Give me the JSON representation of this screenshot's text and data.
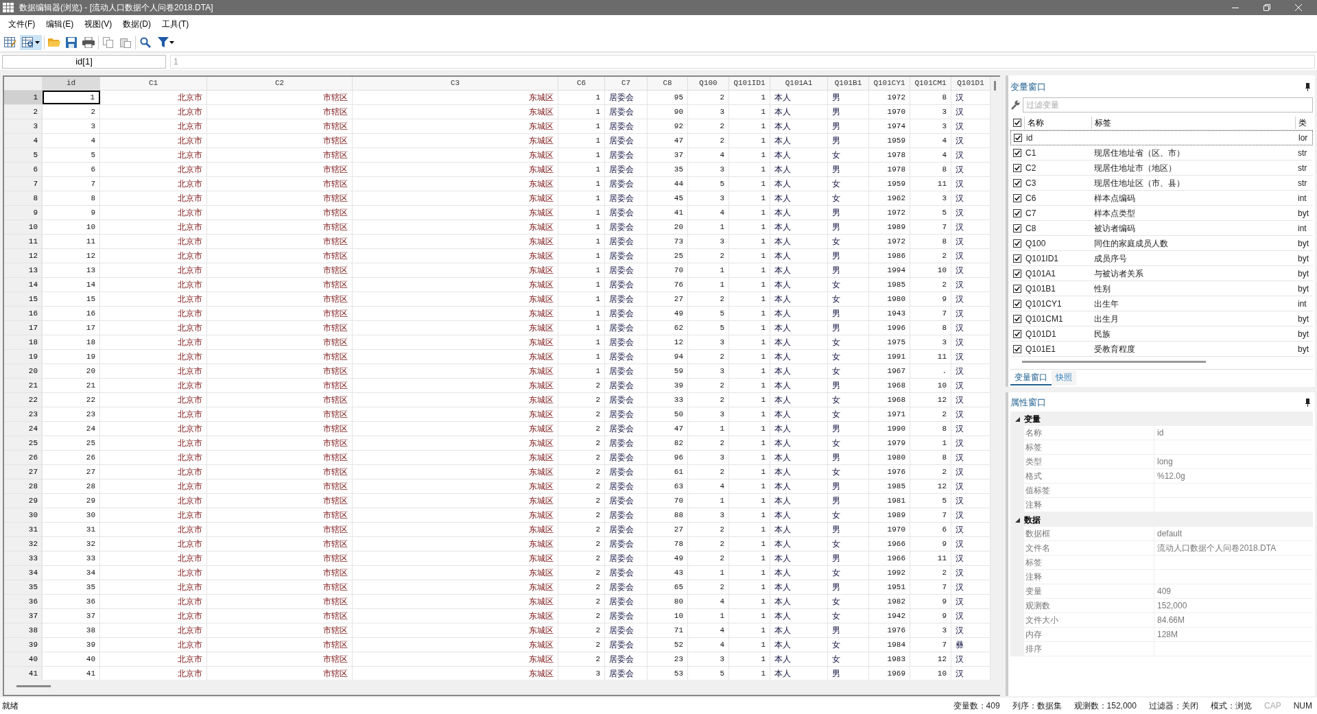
{
  "window": {
    "title": "数据编辑器(浏览) - [流动人口数据个人问卷2018.DTA]"
  },
  "menu": [
    "文件(F)",
    "编辑(E)",
    "视图(V)",
    "数据(D)",
    "工具(T)"
  ],
  "cell_editor": {
    "reference": "id[1]",
    "value": "1"
  },
  "table": {
    "columns": [
      {
        "name": "id",
        "kind": "numeric"
      },
      {
        "name": "C1",
        "kind": "string"
      },
      {
        "name": "C2",
        "kind": "string"
      },
      {
        "name": "C3",
        "kind": "string"
      },
      {
        "name": "C6",
        "kind": "numeric"
      },
      {
        "name": "C7",
        "kind": "labeled"
      },
      {
        "name": "C8",
        "kind": "numeric"
      },
      {
        "name": "Q100",
        "kind": "numeric"
      },
      {
        "name": "Q101ID1",
        "kind": "numeric"
      },
      {
        "name": "Q101A1",
        "kind": "labeled"
      },
      {
        "name": "Q101B1",
        "kind": "labeled"
      },
      {
        "name": "Q101CY1",
        "kind": "numeric"
      },
      {
        "name": "Q101CM1",
        "kind": "numeric"
      },
      {
        "name": "Q101D1",
        "kind": "labeled"
      }
    ],
    "rows": [
      {
        "number": "1",
        "selected": true,
        "cells": [
          "1",
          "北京市",
          "市辖区",
          "东城区",
          "1",
          "居委会",
          "95",
          "2",
          "1",
          "本人",
          "男",
          "1972",
          "8",
          "汉"
        ]
      },
      {
        "number": "2",
        "selected": false,
        "cells": [
          "2",
          "北京市",
          "市辖区",
          "东城区",
          "1",
          "居委会",
          "90",
          "3",
          "1",
          "本人",
          "男",
          "1970",
          "3",
          "汉"
        ]
      },
      {
        "number": "3",
        "selected": false,
        "cells": [
          "3",
          "北京市",
          "市辖区",
          "东城区",
          "1",
          "居委会",
          "92",
          "2",
          "1",
          "本人",
          "男",
          "1974",
          "3",
          "汉"
        ]
      },
      {
        "number": "4",
        "selected": false,
        "cells": [
          "4",
          "北京市",
          "市辖区",
          "东城区",
          "1",
          "居委会",
          "47",
          "2",
          "1",
          "本人",
          "男",
          "1959",
          "4",
          "汉"
        ]
      },
      {
        "number": "5",
        "selected": false,
        "cells": [
          "5",
          "北京市",
          "市辖区",
          "东城区",
          "1",
          "居委会",
          "37",
          "4",
          "1",
          "本人",
          "女",
          "1978",
          "4",
          "汉"
        ]
      },
      {
        "number": "6",
        "selected": false,
        "cells": [
          "6",
          "北京市",
          "市辖区",
          "东城区",
          "1",
          "居委会",
          "35",
          "3",
          "1",
          "本人",
          "男",
          "1978",
          "8",
          "汉"
        ]
      },
      {
        "number": "7",
        "selected": false,
        "cells": [
          "7",
          "北京市",
          "市辖区",
          "东城区",
          "1",
          "居委会",
          "44",
          "5",
          "1",
          "本人",
          "女",
          "1959",
          "11",
          "汉"
        ]
      },
      {
        "number": "8",
        "selected": false,
        "cells": [
          "8",
          "北京市",
          "市辖区",
          "东城区",
          "1",
          "居委会",
          "45",
          "3",
          "1",
          "本人",
          "女",
          "1962",
          "3",
          "汉"
        ]
      },
      {
        "number": "9",
        "selected": false,
        "cells": [
          "9",
          "北京市",
          "市辖区",
          "东城区",
          "1",
          "居委会",
          "41",
          "4",
          "1",
          "本人",
          "男",
          "1972",
          "5",
          "汉"
        ]
      },
      {
        "number": "10",
        "selected": false,
        "cells": [
          "10",
          "北京市",
          "市辖区",
          "东城区",
          "1",
          "居委会",
          "20",
          "1",
          "1",
          "本人",
          "男",
          "1989",
          "7",
          "汉"
        ]
      },
      {
        "number": "11",
        "selected": false,
        "cells": [
          "11",
          "北京市",
          "市辖区",
          "东城区",
          "1",
          "居委会",
          "73",
          "3",
          "1",
          "本人",
          "女",
          "1972",
          "8",
          "汉"
        ]
      },
      {
        "number": "12",
        "selected": false,
        "cells": [
          "12",
          "北京市",
          "市辖区",
          "东城区",
          "1",
          "居委会",
          "25",
          "2",
          "1",
          "本人",
          "男",
          "1986",
          "2",
          "汉"
        ]
      },
      {
        "number": "13",
        "selected": false,
        "cells": [
          "13",
          "北京市",
          "市辖区",
          "东城区",
          "1",
          "居委会",
          "70",
          "1",
          "1",
          "本人",
          "男",
          "1994",
          "10",
          "汉"
        ]
      },
      {
        "number": "14",
        "selected": false,
        "cells": [
          "14",
          "北京市",
          "市辖区",
          "东城区",
          "1",
          "居委会",
          "76",
          "1",
          "1",
          "本人",
          "女",
          "1985",
          "2",
          "汉"
        ]
      },
      {
        "number": "15",
        "selected": false,
        "cells": [
          "15",
          "北京市",
          "市辖区",
          "东城区",
          "1",
          "居委会",
          "27",
          "2",
          "1",
          "本人",
          "女",
          "1980",
          "9",
          "汉"
        ]
      },
      {
        "number": "16",
        "selected": false,
        "cells": [
          "16",
          "北京市",
          "市辖区",
          "东城区",
          "1",
          "居委会",
          "49",
          "5",
          "1",
          "本人",
          "男",
          "1943",
          "7",
          "汉"
        ]
      },
      {
        "number": "17",
        "selected": false,
        "cells": [
          "17",
          "北京市",
          "市辖区",
          "东城区",
          "1",
          "居委会",
          "62",
          "5",
          "1",
          "本人",
          "男",
          "1996",
          "8",
          "汉"
        ]
      },
      {
        "number": "18",
        "selected": false,
        "cells": [
          "18",
          "北京市",
          "市辖区",
          "东城区",
          "1",
          "居委会",
          "12",
          "3",
          "1",
          "本人",
          "女",
          "1975",
          "3",
          "汉"
        ]
      },
      {
        "number": "19",
        "selected": false,
        "cells": [
          "19",
          "北京市",
          "市辖区",
          "东城区",
          "1",
          "居委会",
          "94",
          "2",
          "1",
          "本人",
          "女",
          "1991",
          "11",
          "汉"
        ]
      },
      {
        "number": "20",
        "selected": false,
        "cells": [
          "20",
          "北京市",
          "市辖区",
          "东城区",
          "1",
          "居委会",
          "59",
          "3",
          "1",
          "本人",
          "女",
          "1967",
          ".",
          "汉"
        ]
      },
      {
        "number": "21",
        "selected": false,
        "cells": [
          "21",
          "北京市",
          "市辖区",
          "东城区",
          "2",
          "居委会",
          "39",
          "2",
          "1",
          "本人",
          "男",
          "1968",
          "10",
          "汉"
        ]
      },
      {
        "number": "22",
        "selected": false,
        "cells": [
          "22",
          "北京市",
          "市辖区",
          "东城区",
          "2",
          "居委会",
          "33",
          "2",
          "1",
          "本人",
          "女",
          "1968",
          "12",
          "汉"
        ]
      },
      {
        "number": "23",
        "selected": false,
        "cells": [
          "23",
          "北京市",
          "市辖区",
          "东城区",
          "2",
          "居委会",
          "50",
          "3",
          "1",
          "本人",
          "女",
          "1971",
          "2",
          "汉"
        ]
      },
      {
        "number": "24",
        "selected": false,
        "cells": [
          "24",
          "北京市",
          "市辖区",
          "东城区",
          "2",
          "居委会",
          "47",
          "1",
          "1",
          "本人",
          "男",
          "1990",
          "8",
          "汉"
        ]
      },
      {
        "number": "25",
        "selected": false,
        "cells": [
          "25",
          "北京市",
          "市辖区",
          "东城区",
          "2",
          "居委会",
          "82",
          "2",
          "1",
          "本人",
          "女",
          "1979",
          "1",
          "汉"
        ]
      },
      {
        "number": "26",
        "selected": false,
        "cells": [
          "26",
          "北京市",
          "市辖区",
          "东城区",
          "2",
          "居委会",
          "96",
          "3",
          "1",
          "本人",
          "男",
          "1980",
          "8",
          "汉"
        ]
      },
      {
        "number": "27",
        "selected": false,
        "cells": [
          "27",
          "北京市",
          "市辖区",
          "东城区",
          "2",
          "居委会",
          "61",
          "2",
          "1",
          "本人",
          "女",
          "1976",
          "2",
          "汉"
        ]
      },
      {
        "number": "28",
        "selected": false,
        "cells": [
          "28",
          "北京市",
          "市辖区",
          "东城区",
          "2",
          "居委会",
          "63",
          "4",
          "1",
          "本人",
          "男",
          "1985",
          "12",
          "汉"
        ]
      },
      {
        "number": "29",
        "selected": false,
        "cells": [
          "29",
          "北京市",
          "市辖区",
          "东城区",
          "2",
          "居委会",
          "70",
          "1",
          "1",
          "本人",
          "男",
          "1981",
          "5",
          "汉"
        ]
      },
      {
        "number": "30",
        "selected": false,
        "cells": [
          "30",
          "北京市",
          "市辖区",
          "东城区",
          "2",
          "居委会",
          "88",
          "3",
          "1",
          "本人",
          "女",
          "1989",
          "7",
          "汉"
        ]
      },
      {
        "number": "31",
        "selected": false,
        "cells": [
          "31",
          "北京市",
          "市辖区",
          "东城区",
          "2",
          "居委会",
          "27",
          "2",
          "1",
          "本人",
          "男",
          "1970",
          "6",
          "汉"
        ]
      },
      {
        "number": "32",
        "selected": false,
        "cells": [
          "32",
          "北京市",
          "市辖区",
          "东城区",
          "2",
          "居委会",
          "78",
          "2",
          "1",
          "本人",
          "女",
          "1966",
          "9",
          "汉"
        ]
      },
      {
        "number": "33",
        "selected": false,
        "cells": [
          "33",
          "北京市",
          "市辖区",
          "东城区",
          "2",
          "居委会",
          "49",
          "2",
          "1",
          "本人",
          "男",
          "1966",
          "11",
          "汉"
        ]
      },
      {
        "number": "34",
        "selected": false,
        "cells": [
          "34",
          "北京市",
          "市辖区",
          "东城区",
          "2",
          "居委会",
          "43",
          "1",
          "1",
          "本人",
          "女",
          "1992",
          "2",
          "汉"
        ]
      },
      {
        "number": "35",
        "selected": false,
        "cells": [
          "35",
          "北京市",
          "市辖区",
          "东城区",
          "2",
          "居委会",
          "65",
          "2",
          "1",
          "本人",
          "男",
          "1951",
          "7",
          "汉"
        ]
      },
      {
        "number": "36",
        "selected": false,
        "cells": [
          "36",
          "北京市",
          "市辖区",
          "东城区",
          "2",
          "居委会",
          "80",
          "4",
          "1",
          "本人",
          "女",
          "1982",
          "9",
          "汉"
        ]
      },
      {
        "number": "37",
        "selected": false,
        "cells": [
          "37",
          "北京市",
          "市辖区",
          "东城区",
          "2",
          "居委会",
          "10",
          "1",
          "1",
          "本人",
          "女",
          "1942",
          "9",
          "汉"
        ]
      },
      {
        "number": "38",
        "selected": false,
        "cells": [
          "38",
          "北京市",
          "市辖区",
          "东城区",
          "2",
          "居委会",
          "71",
          "4",
          "1",
          "本人",
          "男",
          "1976",
          "3",
          "汉"
        ]
      },
      {
        "number": "39",
        "selected": false,
        "cells": [
          "39",
          "北京市",
          "市辖区",
          "东城区",
          "2",
          "居委会",
          "52",
          "4",
          "1",
          "本人",
          "女",
          "1984",
          "7",
          "彝"
        ]
      },
      {
        "number": "40",
        "selected": false,
        "cells": [
          "40",
          "北京市",
          "市辖区",
          "东城区",
          "2",
          "居委会",
          "23",
          "3",
          "1",
          "本人",
          "女",
          "1983",
          "12",
          "汉"
        ]
      },
      {
        "number": "41",
        "selected": false,
        "cells": [
          "41",
          "北京市",
          "市辖区",
          "东城区",
          "3",
          "居委会",
          "53",
          "5",
          "1",
          "本人",
          "男",
          "1969",
          "10",
          "汉"
        ]
      }
    ]
  },
  "variables_window": {
    "title": "变量窗口",
    "filter": {
      "placeholder": "过滤变量"
    },
    "columns": {
      "all_checked": true,
      "name": "名称",
      "label": "标签",
      "type": "类"
    },
    "items": [
      {
        "name": "id",
        "type": "lor",
        "checked": true,
        "selected": true
      },
      {
        "name": "C1",
        "label": "现居住地址省（区、市）",
        "type": "str",
        "checked": true,
        "selected": false
      },
      {
        "name": "C2",
        "label": "现居住地址市（地区）",
        "type": "str",
        "checked": true,
        "selected": false
      },
      {
        "name": "C3",
        "label": "现居住地址区（市、县）",
        "type": "str",
        "checked": true,
        "selected": false
      },
      {
        "name": "C6",
        "label": "样本点编码",
        "type": "int",
        "checked": true,
        "selected": false
      },
      {
        "name": "C7",
        "label": "样本点类型",
        "type": "byt",
        "checked": true,
        "selected": false
      },
      {
        "name": "C8",
        "label": "被访者编码",
        "type": "int",
        "checked": true,
        "selected": false
      },
      {
        "name": "Q100",
        "label": "同住的家庭成员人数",
        "type": "byt",
        "checked": true,
        "selected": false
      },
      {
        "name": "Q101ID1",
        "label": "成员序号",
        "type": "byt",
        "checked": true,
        "selected": false
      },
      {
        "name": "Q101A1",
        "label": "与被访者关系",
        "type": "byt",
        "checked": true,
        "selected": false
      },
      {
        "name": "Q101B1",
        "label": "性别",
        "type": "byt",
        "checked": true,
        "selected": false
      },
      {
        "name": "Q101CY1",
        "label": "出生年",
        "type": "int",
        "checked": true,
        "selected": false
      },
      {
        "name": "Q101CM1",
        "label": "出生月",
        "type": "byt",
        "checked": true,
        "selected": false
      },
      {
        "name": "Q101D1",
        "label": "民族",
        "type": "byt",
        "checked": true,
        "selected": false
      },
      {
        "name": "Q101E1",
        "label": "受教育程度",
        "type": "byt",
        "checked": true,
        "selected": false
      }
    ],
    "tabs": [
      {
        "label": "变量窗口",
        "selected": true
      },
      {
        "label": "快照",
        "selected": false
      }
    ]
  },
  "properties_window": {
    "title": "属性窗口",
    "groups": [
      {
        "title": "变量",
        "expanded": true,
        "items": [
          {
            "name": "名称",
            "value": "id"
          },
          {
            "name": "标签"
          },
          {
            "name": "类型",
            "value": "long"
          },
          {
            "name": "格式",
            "value": "%12.0g"
          },
          {
            "name": "值标签"
          },
          {
            "name": "注释"
          }
        ]
      },
      {
        "title": "数据",
        "expanded": true,
        "items": [
          {
            "name": "数据框",
            "value": "default"
          },
          {
            "name": "文件名",
            "value": "流动人口数据个人问卷2018.DTA"
          },
          {
            "name": "标签"
          },
          {
            "name": "注释"
          },
          {
            "name": "变量",
            "value": "409"
          },
          {
            "name": "观测数",
            "value": "152,000"
          },
          {
            "name": "文件大小",
            "value": "84.66M"
          },
          {
            "name": "内存",
            "value": "128M"
          },
          {
            "name": "排序"
          }
        ]
      }
    ]
  },
  "status_bar": {
    "message": "就绪",
    "fields": [
      {
        "text": "变量数：409",
        "disabled": false
      },
      {
        "text": "列序：数据集",
        "disabled": false
      },
      {
        "text": "观测数：152,000",
        "disabled": false
      },
      {
        "text": "过滤器：关闭",
        "disabled": false
      },
      {
        "text": "模式：浏览",
        "disabled": false
      },
      {
        "text": "CAP",
        "disabled": true
      },
      {
        "text": "NUM",
        "disabled": false
      }
    ]
  }
}
